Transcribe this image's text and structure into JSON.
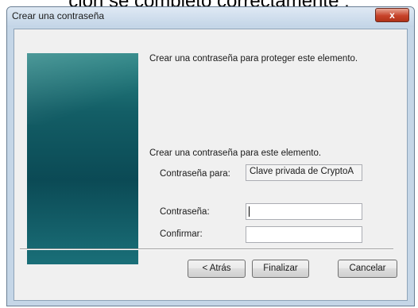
{
  "background": {
    "text": "ción se completó correctamente ."
  },
  "window": {
    "title": "Crear una contraseña",
    "close_glyph": "x"
  },
  "dialog": {
    "intro": "Crear una contraseña para proteger este elemento.",
    "instruction": "Crear una contraseña para este elemento.",
    "password_for": {
      "label": "Contraseña para:",
      "value": "Clave privada de CryptoA"
    },
    "password": {
      "label": "Contraseña:",
      "value": ""
    },
    "confirm": {
      "label": "Confirmar:",
      "value": ""
    }
  },
  "buttons": {
    "back": "< Atrás",
    "finish": "Finalizar",
    "cancel": "Cancelar"
  },
  "colors": {
    "panel": "#135e66",
    "close": "#c7432a",
    "frame": "#c5d6e7"
  }
}
